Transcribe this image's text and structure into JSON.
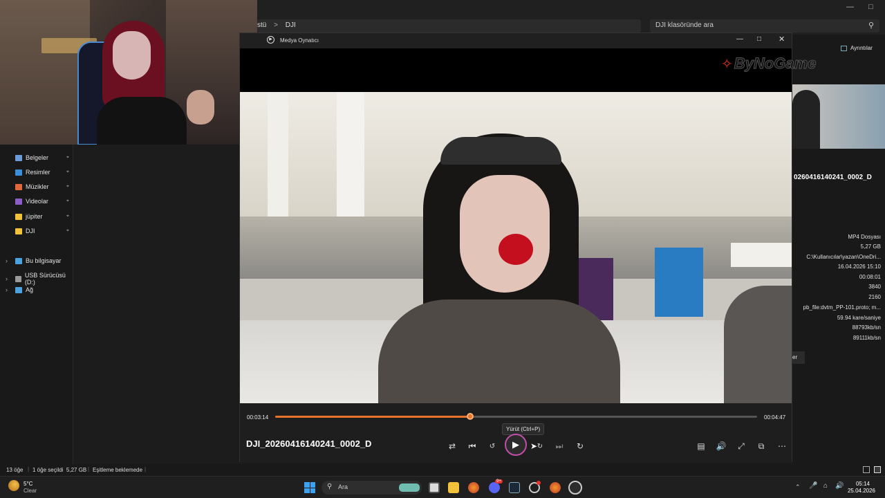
{
  "explorer": {
    "breadcrumb_prefix": "stü",
    "breadcrumb_sep": ">",
    "breadcrumb_folder": "DJI",
    "search_placeholder": "DJI klasöründe ara",
    "details_button": "Ayrıntılar",
    "nav": [
      {
        "label": "Belgeler",
        "icon": "documents-icon"
      },
      {
        "label": "Resimler",
        "icon": "pictures-icon"
      },
      {
        "label": "Müzikler",
        "icon": "music-icon"
      },
      {
        "label": "Videolar",
        "icon": "videos-icon"
      },
      {
        "label": "jüpiter",
        "icon": "folder-icon"
      },
      {
        "label": "DJI",
        "icon": "folder-icon"
      },
      {
        "label": "Bu bilgisayar",
        "icon": "computer-icon"
      },
      {
        "label": "USB Sürücüsü (D:)",
        "icon": "usb-drive-icon"
      },
      {
        "label": "Ağ",
        "icon": "network-icon"
      }
    ],
    "details": {
      "filename": "0260416140241_0002_D",
      "rows": [
        "MP4 Dosyası",
        "5,27 GB",
        "C:\\Kullanıcılar\\yazan\\OneDri...",
        "16.04.2026 15:10",
        "00:08:01",
        "3840",
        "2160",
        "pb_file:dvtm_PP-101.proto; m...",
        "59.94 kare/saniye",
        "88793kb/sn",
        "89111kb/sn"
      ],
      "partial_button": "er"
    },
    "status": {
      "count": "13 öğe",
      "selected": "1 öğe seçildi  5,27 GB",
      "sync": "Eşitleme beklemede"
    }
  },
  "player": {
    "window_title": "Medya Oynatıcı",
    "filename": "DJI_20260416140241_0002_D",
    "time_current": "00:03:14",
    "time_total": "00:04:47",
    "progress": 0.405,
    "tooltip": "Yürüt (Ctrl+P)",
    "watermark": "ByNoGame",
    "accent": "#e8732a"
  },
  "taskbar": {
    "weather_temp": "5°C",
    "weather_cond": "Clear",
    "search": "Ara",
    "time": "05:14",
    "date": "25.04.2026",
    "discord_badge": "9+"
  }
}
